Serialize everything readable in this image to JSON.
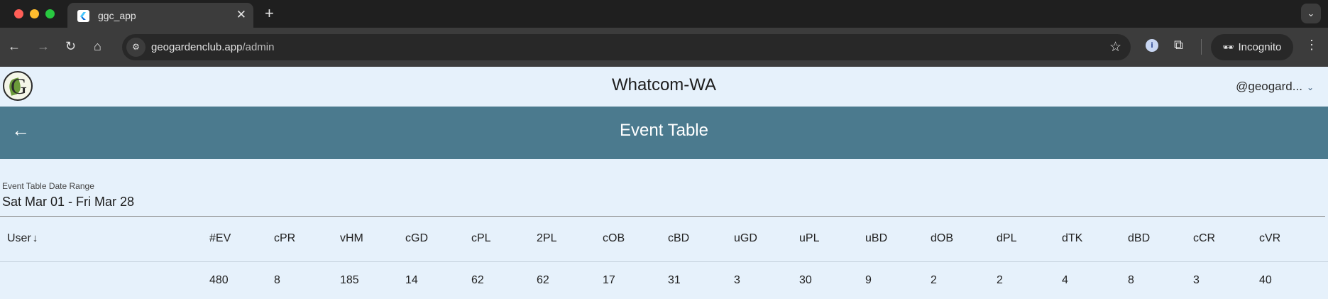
{
  "browser": {
    "tab_title": "ggc_app",
    "url_domain": "geogardenclub.app",
    "url_path": "/admin",
    "incognito_label": "Incognito"
  },
  "app": {
    "region": "Whatcom-WA",
    "user": "@geogard...",
    "page_title": "Event Table"
  },
  "date_range": {
    "label": "Event Table Date Range",
    "value": "Sat Mar 01 - Fri Mar 28"
  },
  "table": {
    "columns": [
      "User",
      "#EV",
      "cPR",
      "vHM",
      "cGD",
      "cPL",
      "2PL",
      "cOB",
      "cBD",
      "uGD",
      "uPL",
      "uBD",
      "dOB",
      "dPL",
      "dTK",
      "dBD",
      "cCR",
      "cVR"
    ],
    "rows": [
      [
        "",
        "480",
        "8",
        "185",
        "14",
        "62",
        "62",
        "17",
        "31",
        "3",
        "30",
        "9",
        "2",
        "2",
        "4",
        "8",
        "3",
        "40"
      ]
    ]
  },
  "colors": {
    "header_bg": "#4b7a8e",
    "page_bg": "#e6f1fb"
  }
}
